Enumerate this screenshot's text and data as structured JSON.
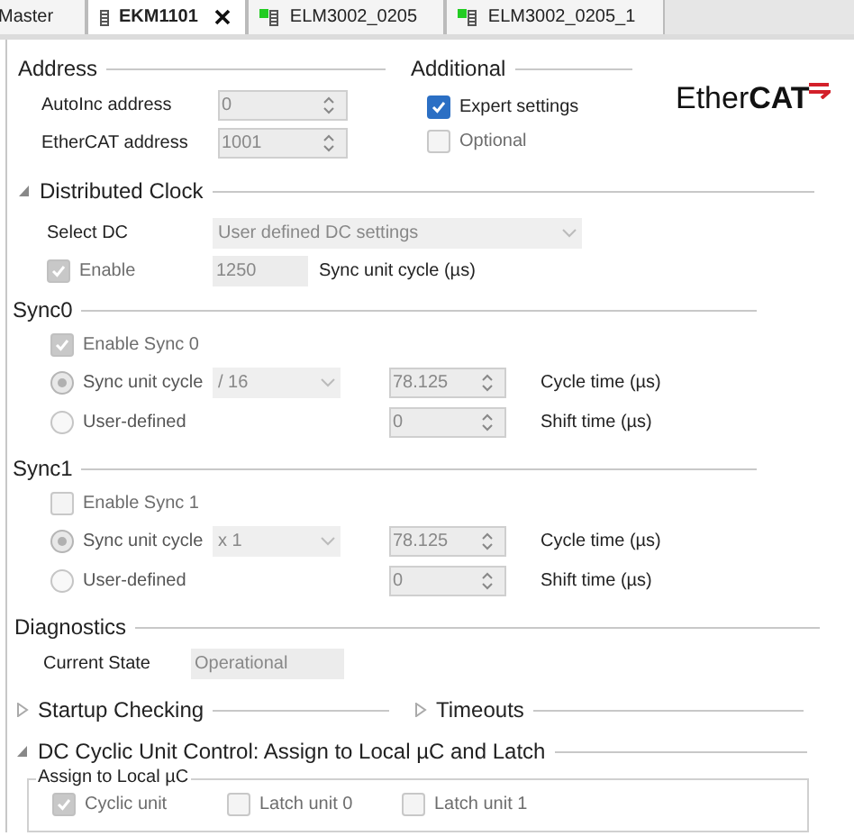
{
  "tabs": [
    {
      "label": "Master",
      "selected": false,
      "kind": "plain"
    },
    {
      "label": "EKM1101",
      "selected": true,
      "kind": "device",
      "online": false
    },
    {
      "label": "ELM3002_0205",
      "selected": false,
      "kind": "device",
      "online": true
    },
    {
      "label": "ELM3002_0205_1",
      "selected": false,
      "kind": "device",
      "online": true
    }
  ],
  "address": {
    "title": "Address",
    "fields": [
      {
        "label": "AutoInc address",
        "value": "0"
      },
      {
        "label": "EtherCAT address",
        "value": "1001"
      }
    ]
  },
  "additional": {
    "title": "Additional",
    "options": [
      {
        "label": "Expert settings",
        "checked": true,
        "disabled": false
      },
      {
        "label": "Optional",
        "checked": false,
        "disabled": true
      }
    ]
  },
  "logo": "Ether**CAT**",
  "distributed_clock": {
    "title": "Distributed Clock",
    "expanded": true,
    "select_dc": {
      "label": "Select DC",
      "value": "User defined DC settings"
    },
    "enable": {
      "label": "Enable",
      "checked": true,
      "disabled": true
    },
    "cycle": {
      "value": "1250",
      "unit": "Sync unit cycle (µs)"
    }
  },
  "syncs": [
    {
      "title": "Sync0",
      "enable": {
        "label": "Enable Sync 0",
        "checked": true,
        "disabled": true
      },
      "modes": [
        {
          "label": "Sync unit cycle",
          "selected": true,
          "divider": "/ 16",
          "value": "78.125",
          "unit": "Cycle time (µs)"
        },
        {
          "label": "User-defined",
          "selected": false,
          "value": "0",
          "unit": "Shift time (µs)"
        }
      ]
    },
    {
      "title": "Sync1",
      "enable": {
        "label": "Enable Sync 1",
        "checked": false,
        "disabled": true
      },
      "modes": [
        {
          "label": "Sync unit cycle",
          "selected": true,
          "divider": "x 1",
          "value": "78.125",
          "unit": "Cycle time (µs)"
        },
        {
          "label": "User-defined",
          "selected": false,
          "value": "0",
          "unit": "Shift time (µs)"
        }
      ]
    }
  ],
  "diagnostics": {
    "title": "Diagnostics",
    "current_state": {
      "label": "Current State",
      "value": "Operational"
    }
  },
  "collapsibles": [
    {
      "title": "Startup Checking",
      "expanded": false
    },
    {
      "title": "Timeouts",
      "expanded": false
    }
  ],
  "dc_cyclic": {
    "title": "DC Cyclic Unit Control: Assign to Local µC and Latch",
    "expanded": true,
    "group": {
      "title": "Assign to Local µC",
      "options": [
        {
          "label": "Cyclic unit",
          "checked": true,
          "disabled": true
        },
        {
          "label": "Latch unit 0",
          "checked": false,
          "disabled": true
        },
        {
          "label": "Latch unit 1",
          "checked": false,
          "disabled": true
        }
      ]
    }
  }
}
